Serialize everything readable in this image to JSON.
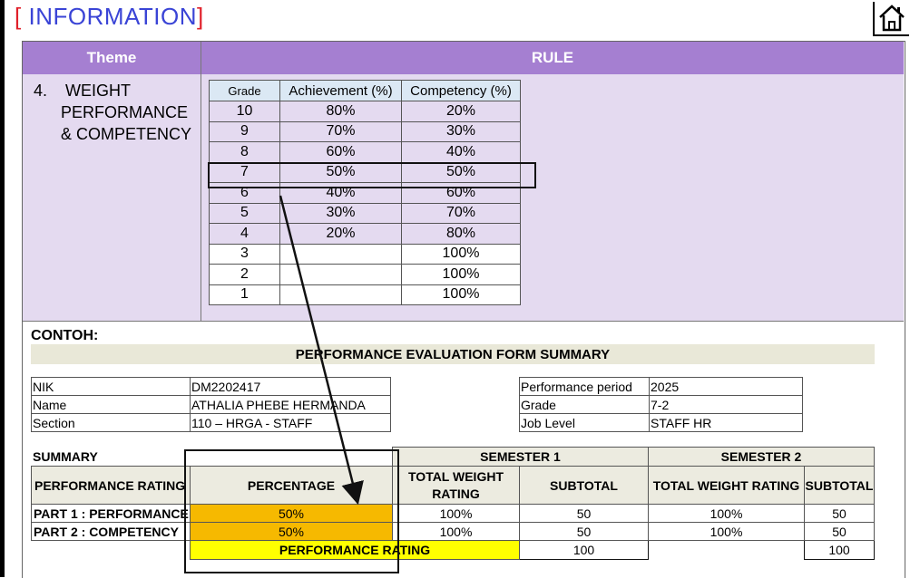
{
  "header": {
    "bracket_open": "[",
    "title": "INFORMATION",
    "bracket_close": "]",
    "home_icon": "home-icon"
  },
  "rule_table": {
    "col_theme": "Theme",
    "col_rule": "RULE",
    "theme_text": "4.    WEIGHT\n      PERFORMANCE\n      & COMPETENCY",
    "grade_headers": [
      "Grade",
      "Achievement (%)",
      "Competency (%)"
    ],
    "grades": [
      [
        "10",
        "80%",
        "20%"
      ],
      [
        "9",
        "70%",
        "30%"
      ],
      [
        "8",
        "60%",
        "40%"
      ],
      [
        "7",
        "50%",
        "50%"
      ],
      [
        "6",
        "40%",
        "60%"
      ],
      [
        "5",
        "30%",
        "70%"
      ],
      [
        "4",
        "20%",
        "80%"
      ],
      [
        "3",
        "",
        "100%"
      ],
      [
        "2",
        "",
        "100%"
      ],
      [
        "1",
        "",
        "100%"
      ]
    ]
  },
  "example": {
    "label": "CONTOH:",
    "form_title": "PERFORMANCE EVALUATION FORM SUMMARY",
    "info_left": [
      [
        "NIK",
        "DM2202417"
      ],
      [
        "Name",
        "ATHALIA PHEBE HERMANDA"
      ],
      [
        "Section",
        "110 – HRGA - STAFF"
      ]
    ],
    "info_right": [
      [
        "Performance period",
        "2025"
      ],
      [
        "Grade",
        "7-2"
      ],
      [
        "Job Level",
        "STAFF HR"
      ]
    ],
    "summary_label": "SUMMARY",
    "semester1": "SEMESTER 1",
    "semester2": "SEMESTER 2",
    "col_perf_rating": "PERFORMANCE RATING",
    "col_percentage": "PERCENTAGE",
    "col_total_weight": "TOTAL WEIGHT RATING",
    "col_subtotal": "SUBTOTAL",
    "col_total_weight2": "TOTAL WEIGHT RATING",
    "col_subtotal2": "SUBTOTAL",
    "rows": [
      {
        "label": "PART 1 : PERFORMANCE",
        "pct": "50%",
        "tw1": "100%",
        "sub1": "50",
        "tw2": "100%",
        "sub2": "50"
      },
      {
        "label": "PART 2 : COMPETENCY",
        "pct": "50%",
        "tw1": "100%",
        "sub1": "50",
        "tw2": "100%",
        "sub2": "50"
      }
    ],
    "perf_rating_label": "PERFORMANCE RATING",
    "total1": "100",
    "total2": "100"
  },
  "colors": {
    "title_blue": "#3a44d6",
    "bracket_red": "#e0202a",
    "header_purple": "#a57fd1",
    "cell_lavender": "#e4daf0",
    "percentage_orange": "#f6b900",
    "rating_yellow": "#ffff00"
  }
}
